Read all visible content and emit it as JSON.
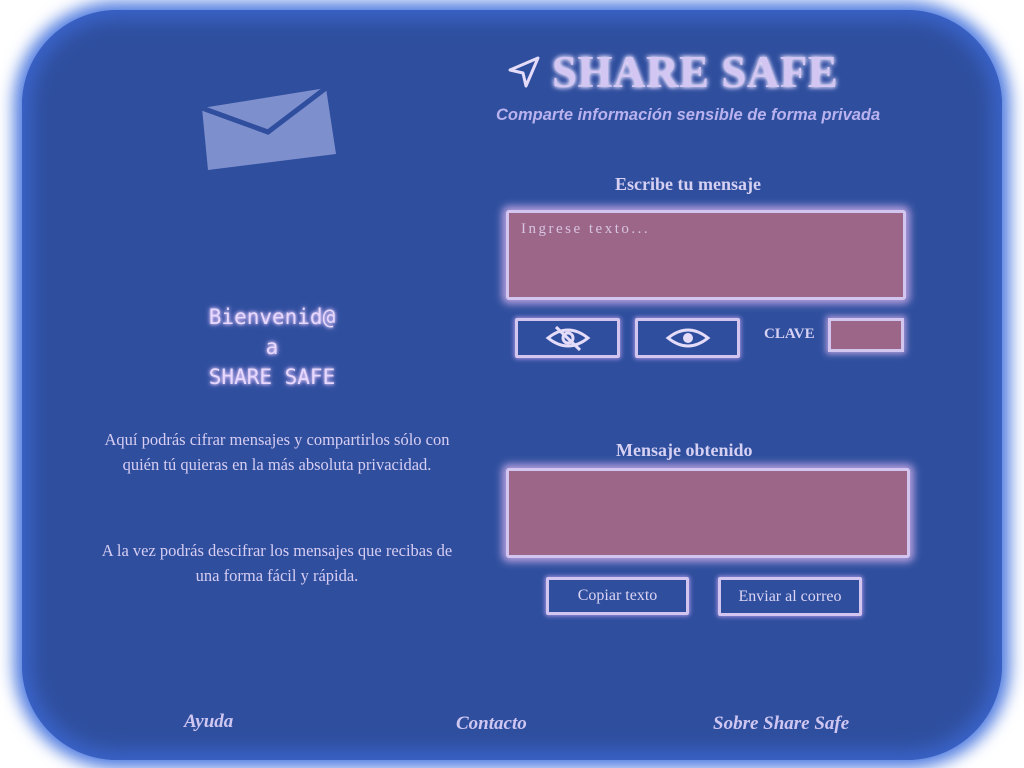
{
  "header": {
    "title": "SHARE SAFE",
    "subtitle": "Comparte información sensible de forma privada"
  },
  "welcome": {
    "line1": "Bienvenid@",
    "line2": "a",
    "line3": "SHARE SAFE"
  },
  "description": {
    "paragraph1": "Aquí podrás cifrar mensajes y compartirlos sólo con quién tú quieras en la más absoluta privacidad.",
    "paragraph2": "A la vez podrás descifrar los mensajes que recibas de una forma fácil y rápida."
  },
  "input_section": {
    "label": "Escribe tu mensaje",
    "placeholder": "Ingrese texto...",
    "value": ""
  },
  "actions": {
    "encrypt_icon": "eye-off-icon",
    "decrypt_icon": "eye-icon",
    "key_label": "CLAVE",
    "key_value": ""
  },
  "output_section": {
    "label": "Mensaje obtenido",
    "value": "",
    "copy_label": "Copiar texto",
    "email_label": "Enviar al correo"
  },
  "footer": {
    "help": "Ayuda",
    "contact": "Contacto",
    "about": "Sobre Share Safe"
  },
  "colors": {
    "panel": "#2f4f9e",
    "field": "#9c6688",
    "accent_text": "#d3c6f3"
  },
  "icons": {
    "logo": "send-icon",
    "decoration": "envelope-icon"
  }
}
